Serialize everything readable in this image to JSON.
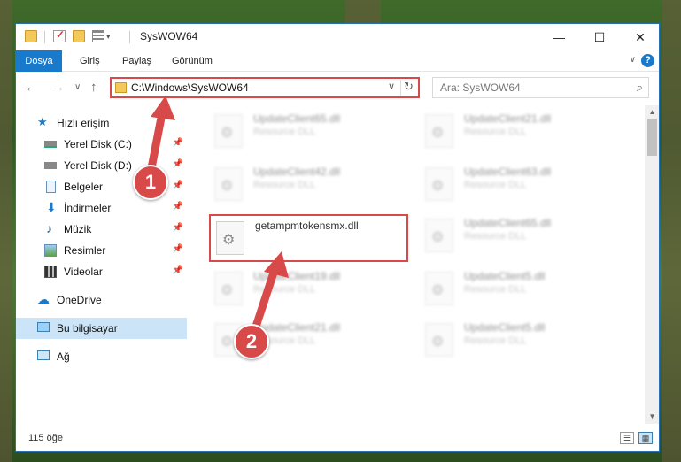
{
  "titlebar": {
    "title": "SysWOW64",
    "minimize": "—",
    "maximize": "☐",
    "close": "✕"
  },
  "ribbon": {
    "tabs": [
      "Dosya",
      "Giriş",
      "Paylaş",
      "Görünüm"
    ],
    "help": "?",
    "collapse": "∨"
  },
  "nav": {
    "back": "←",
    "forward": "→",
    "recent": "∨",
    "up": "↑",
    "address": "C:\\Windows\\SysWOW64",
    "search_placeholder": "Ara: SysWOW64",
    "dropdown": "∨",
    "refresh": "↻",
    "search_icon": "⌕"
  },
  "sidebar": {
    "quick_access": "Hızlı erişim",
    "items": [
      {
        "label": "Yerel Disk (C:)",
        "pinned": true
      },
      {
        "label": "Yerel Disk (D:)",
        "pinned": true
      },
      {
        "label": "Belgeler",
        "pinned": true
      },
      {
        "label": "İndirmeler",
        "pinned": true
      },
      {
        "label": "Müzik",
        "pinned": true
      },
      {
        "label": "Resimler",
        "pinned": true
      },
      {
        "label": "Videolar",
        "pinned": true
      }
    ],
    "onedrive": "OneDrive",
    "this_pc": "Bu bilgisayar",
    "network": "Ağ",
    "pin_glyph": "📌"
  },
  "files": {
    "left": [
      {
        "name": "UpdateClient65.dll",
        "type": "Resource DLL"
      },
      {
        "name": "UpdateClient42.dll",
        "type": "Resource DLL"
      },
      {
        "name": "getampmtokensmx.dll",
        "type": ""
      },
      {
        "name": "UpdateClient19.dll",
        "type": "Resource DLL"
      },
      {
        "name": "UpdateClient21.dll",
        "type": "Resource DLL"
      }
    ],
    "right": [
      {
        "name": "UpdateClient21.dll",
        "type": "Resource DLL"
      },
      {
        "name": "UpdateClient63.dll",
        "type": "Resource DLL"
      },
      {
        "name": "UpdateClient65.dll",
        "type": "Resource DLL"
      },
      {
        "name": "UpdateClient5.dll",
        "type": "Resource DLL"
      },
      {
        "name": "UpdateClient5.dll",
        "type": "Resource DLL"
      }
    ]
  },
  "status": {
    "item_count": "115 öğe"
  },
  "annotations": {
    "step1": "1",
    "step2": "2",
    "color": "#d84949"
  }
}
